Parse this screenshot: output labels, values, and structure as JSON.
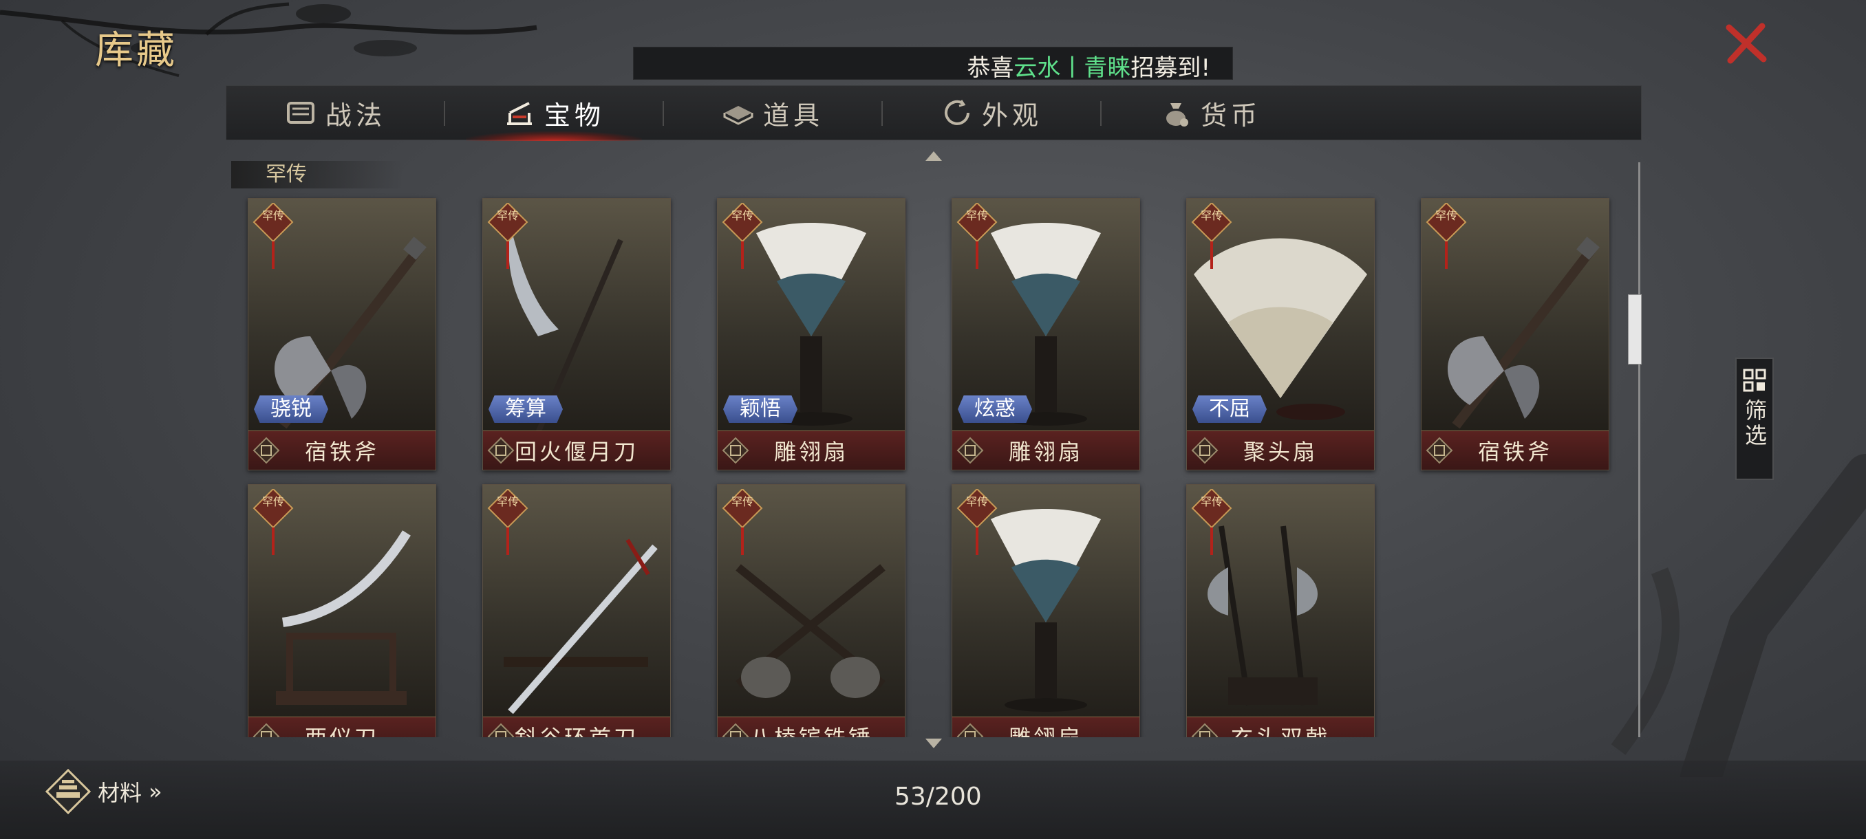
{
  "header": {
    "title": "库藏"
  },
  "ticker": {
    "prefix": "恭喜",
    "name1": "云水",
    "sep": "丨",
    "name2": "青睐",
    "suffix": "招募到!"
  },
  "tabs": [
    {
      "label": "战法",
      "icon": "scroll-icon"
    },
    {
      "label": "宝物",
      "icon": "weapon-rack-icon",
      "active": true
    },
    {
      "label": "道具",
      "icon": "tablet-icon"
    },
    {
      "label": "外观",
      "icon": "swirl-icon"
    },
    {
      "label": "货币",
      "icon": "money-bag-icon"
    }
  ],
  "section": {
    "label": "罕传"
  },
  "items": [
    {
      "name": "宿铁斧",
      "skill": "骁锐",
      "tag": "罕传",
      "art": "axe"
    },
    {
      "name": "回火偃月刀",
      "skill": "筹算",
      "tag": "罕传",
      "art": "glaive"
    },
    {
      "name": "雕翎扇",
      "skill": "颖悟",
      "tag": "罕传",
      "art": "fan"
    },
    {
      "name": "雕翎扇",
      "skill": "炫惑",
      "tag": "罕传",
      "art": "fan"
    },
    {
      "name": "聚头扇",
      "skill": "不屈",
      "tag": "罕传",
      "art": "folding-fan"
    },
    {
      "name": "宿铁斧",
      "skill": "",
      "tag": "罕传",
      "art": "axe"
    },
    {
      "name": "两仪刀",
      "skill": "",
      "tag": "罕传",
      "art": "sword-stand"
    },
    {
      "name": "斜谷环首刀",
      "skill": "",
      "tag": "罕传",
      "art": "katana"
    },
    {
      "name": "八棱镔铁锤",
      "skill": "",
      "tag": "罕传",
      "art": "hammers"
    },
    {
      "name": "雕翎扇",
      "skill": "",
      "tag": "罕传",
      "art": "fan"
    },
    {
      "name": "玄头双戟",
      "skill": "",
      "tag": "罕传",
      "art": "halberds"
    }
  ],
  "filter": {
    "label": "筛选"
  },
  "footer": {
    "materials_label": "材料",
    "materials_arrow": "»",
    "count": "53/200"
  },
  "colors": {
    "accent_gold": "#e7c98a",
    "ticker_green": "#5fe08b",
    "close_red": "#c0302a",
    "skill_blue": "#4f66ad"
  }
}
